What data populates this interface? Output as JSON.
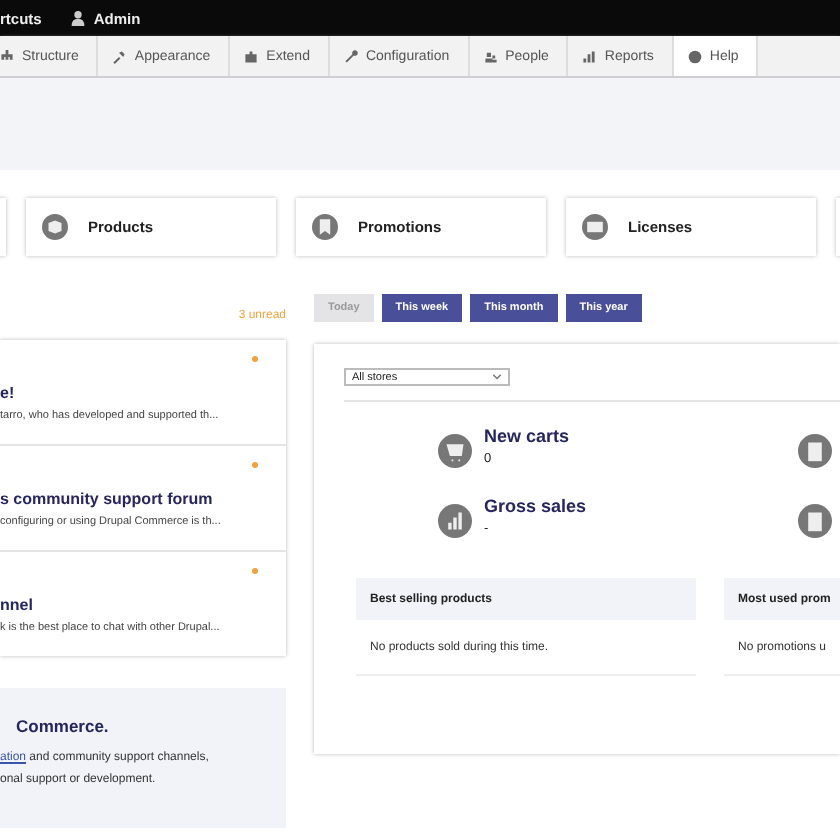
{
  "top_bar": {
    "shortcuts": "rtcuts",
    "user": "Admin"
  },
  "admin_menu": [
    {
      "label": "Structure",
      "selected": false
    },
    {
      "label": "Appearance",
      "selected": false
    },
    {
      "label": "Extend",
      "selected": false
    },
    {
      "label": "Configuration",
      "selected": false
    },
    {
      "label": "People",
      "selected": false
    },
    {
      "label": "Reports",
      "selected": false
    },
    {
      "label": "Help",
      "selected": true
    }
  ],
  "shortcut_cards": [
    {
      "label": "Products"
    },
    {
      "label": "Promotions"
    },
    {
      "label": "Licenses"
    }
  ],
  "messages": {
    "unread_count": "3 unread",
    "items": [
      {
        "title": "e!",
        "text": "tarro, who has developed and supported th...",
        "unread": true
      },
      {
        "title": "s community support forum",
        "text": "configuring or using Drupal Commerce is th...",
        "unread": true
      },
      {
        "title": "nnel",
        "text": "k is the best place to chat with other Drupal...",
        "unread": true
      }
    ]
  },
  "info_box": {
    "title": "Commerce.",
    "link": "ation",
    "line_1": " and community support channels,",
    "line_2": "onal support or development."
  },
  "date_filters": [
    {
      "label": "Today",
      "selected": true
    },
    {
      "label": "This week",
      "selected": false
    },
    {
      "label": "This month",
      "selected": false
    },
    {
      "label": "This year",
      "selected": false
    }
  ],
  "store_select": {
    "value": "All stores"
  },
  "stats": [
    {
      "title": "New carts",
      "value": "0"
    },
    {
      "title": "Gross sales",
      "value": "-"
    }
  ],
  "tables": [
    {
      "title": "Best selling products",
      "empty_text": "No products sold during this time."
    },
    {
      "title": "Most used prom",
      "empty_text": "No promotions u"
    }
  ]
}
